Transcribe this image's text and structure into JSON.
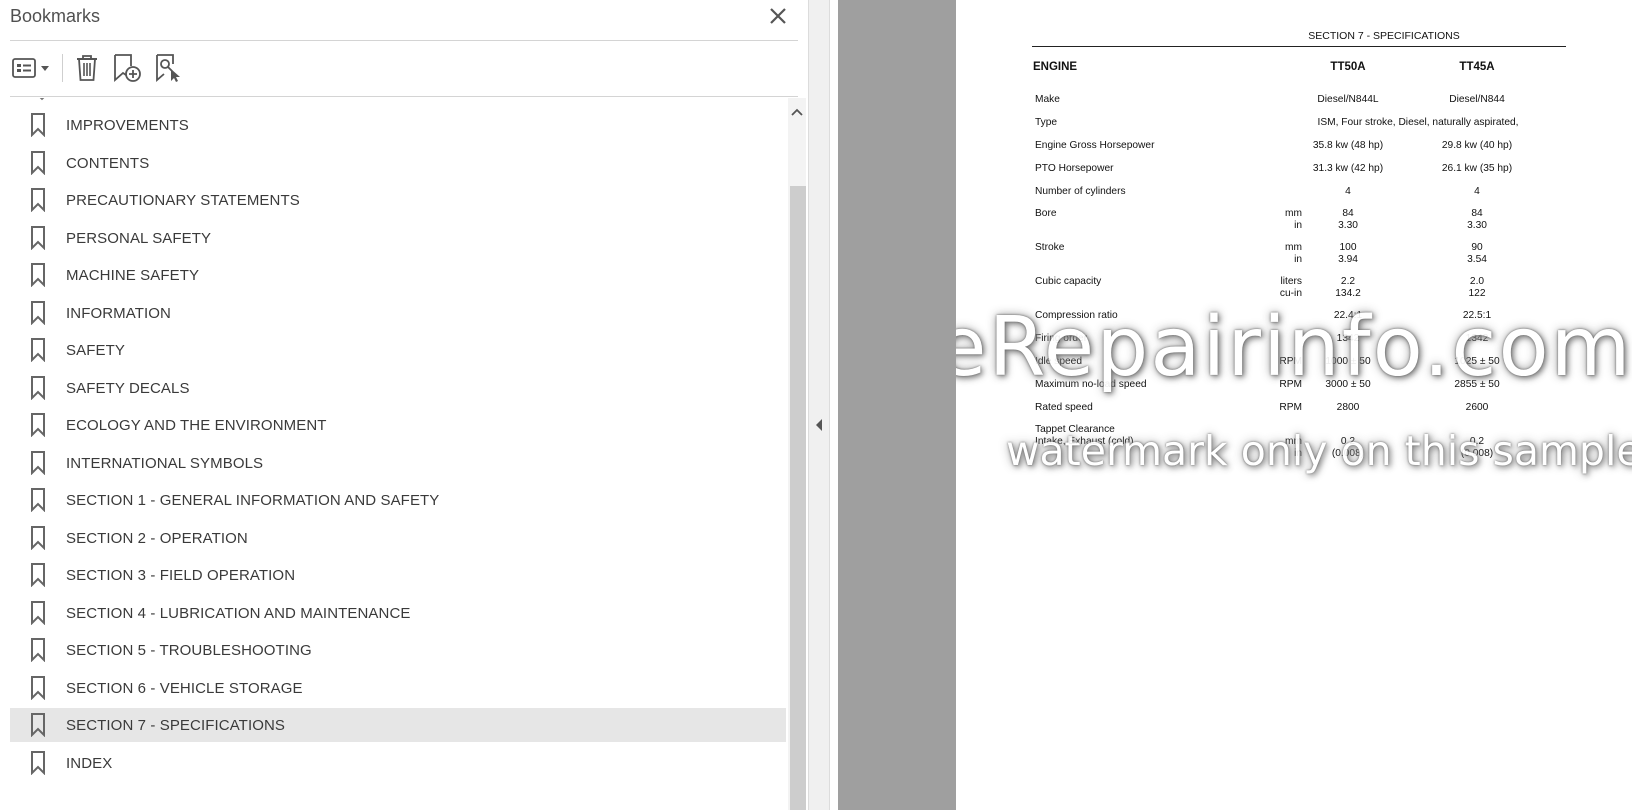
{
  "panel": {
    "title": "Bookmarks",
    "toolbar": {
      "options_icon": "list-options-icon",
      "delete_icon": "trash-icon",
      "new_bookmark_icon": "new-bookmark-icon",
      "find_bookmark_icon": "find-bookmark-icon"
    },
    "bookmarks": [
      {
        "label": "IMPROVEMENTS",
        "selected": false
      },
      {
        "label": "CONTENTS",
        "selected": false
      },
      {
        "label": "PRECAUTIONARY STATEMENTS",
        "selected": false
      },
      {
        "label": "PERSONAL SAFETY",
        "selected": false
      },
      {
        "label": "MACHINE SAFETY",
        "selected": false
      },
      {
        "label": "INFORMATION",
        "selected": false
      },
      {
        "label": "SAFETY",
        "selected": false
      },
      {
        "label": "SAFETY DECALS",
        "selected": false
      },
      {
        "label": "ECOLOGY AND THE ENVIRONMENT",
        "selected": false
      },
      {
        "label": "INTERNATIONAL SYMBOLS",
        "selected": false
      },
      {
        "label": "SECTION 1 - GENERAL INFORMATION AND SAFETY",
        "selected": false
      },
      {
        "label": "SECTION 2 - OPERATION",
        "selected": false
      },
      {
        "label": "SECTION 3 - FIELD OPERATION",
        "selected": false
      },
      {
        "label": "SECTION 4 - LUBRICATION AND MAINTENANCE",
        "selected": false
      },
      {
        "label": "SECTION 5 - TROUBLESHOOTING",
        "selected": false
      },
      {
        "label": "SECTION 6 - VEHICLE STORAGE",
        "selected": false
      },
      {
        "label": "SECTION 7 - SPECIFICATIONS",
        "selected": true
      },
      {
        "label": "INDEX",
        "selected": false
      }
    ]
  },
  "document": {
    "header": "SECTION 7 - SPECIFICATIONS",
    "section": "ENGINE",
    "col1": "TT50A",
    "col2": "TT45A",
    "rows": [
      {
        "label": "Make",
        "unit": "",
        "unit2": "",
        "v1": "Diesel/N844L",
        "v1b": "",
        "v2": "Diesel/N844",
        "v2b": ""
      },
      {
        "label": "Type",
        "unit": "",
        "unit2": "",
        "wide": "ISM, Four stroke, Diesel, naturally aspirated,"
      },
      {
        "label": "Engine Gross Horsepower",
        "unit": "",
        "unit2": "",
        "v1": "35.8 kw (48 hp)",
        "v1b": "",
        "v2": "29.8 kw (40 hp)",
        "v2b": ""
      },
      {
        "label": "PTO Horsepower",
        "unit": "",
        "unit2": "",
        "v1": "31.3 kw (42 hp)",
        "v1b": "",
        "v2": "26.1 kw (35 hp)",
        "v2b": ""
      },
      {
        "label": "Number of cylinders",
        "unit": "",
        "unit2": "",
        "v1": "4",
        "v1b": "",
        "v2": "4",
        "v2b": ""
      },
      {
        "label": "Bore",
        "unit": "mm",
        "unit2": "in",
        "v1": "84",
        "v1b": "3.30",
        "v2": "84",
        "v2b": "3.30"
      },
      {
        "label": "Stroke",
        "unit": "mm",
        "unit2": "in",
        "v1": "100",
        "v1b": "3.94",
        "v2": "90",
        "v2b": "3.54"
      },
      {
        "label": "Cubic capacity",
        "unit": "liters",
        "unit2": "cu-in",
        "v1": "2.2",
        "v1b": "134.2",
        "v2": "2.0",
        "v2b": "122"
      },
      {
        "label": "Compression ratio",
        "unit": "",
        "unit2": "",
        "v1": "22.4:1",
        "v1b": "",
        "v2": "22.5:1",
        "v2b": ""
      },
      {
        "label": "Firing order",
        "unit": "",
        "unit2": "",
        "v1": "1342",
        "v1b": "",
        "v2": "1342",
        "v2b": ""
      },
      {
        "label": "Idle speed",
        "unit": "RPM",
        "unit2": "",
        "v1": "1000 ± 50",
        "v1b": "",
        "v2": "1025 ± 50",
        "v2b": ""
      },
      {
        "label": "Maximum no-load speed",
        "unit": "RPM",
        "unit2": "",
        "v1": "3000 ± 50",
        "v1b": "",
        "v2": "2855 ± 50",
        "v2b": ""
      },
      {
        "label": "Rated speed",
        "unit": "RPM",
        "unit2": "",
        "v1": "2800",
        "v1b": "",
        "v2": "2600",
        "v2b": ""
      },
      {
        "label": "Tappet Clearance",
        "unit": "",
        "unit2": "",
        "v1": "",
        "v1b": "",
        "v2": "",
        "v2b": ""
      },
      {
        "label": "Intake, Exhaust (cold)",
        "unit": "mm",
        "unit2": "in",
        "v1": "0.2",
        "v1b": "(0.008)",
        "v2": "0.2",
        "v2b": "(0.008)"
      }
    ],
    "watermark": {
      "main": "eRepairinfo.com",
      "sub": "watermark only on this sample"
    }
  }
}
